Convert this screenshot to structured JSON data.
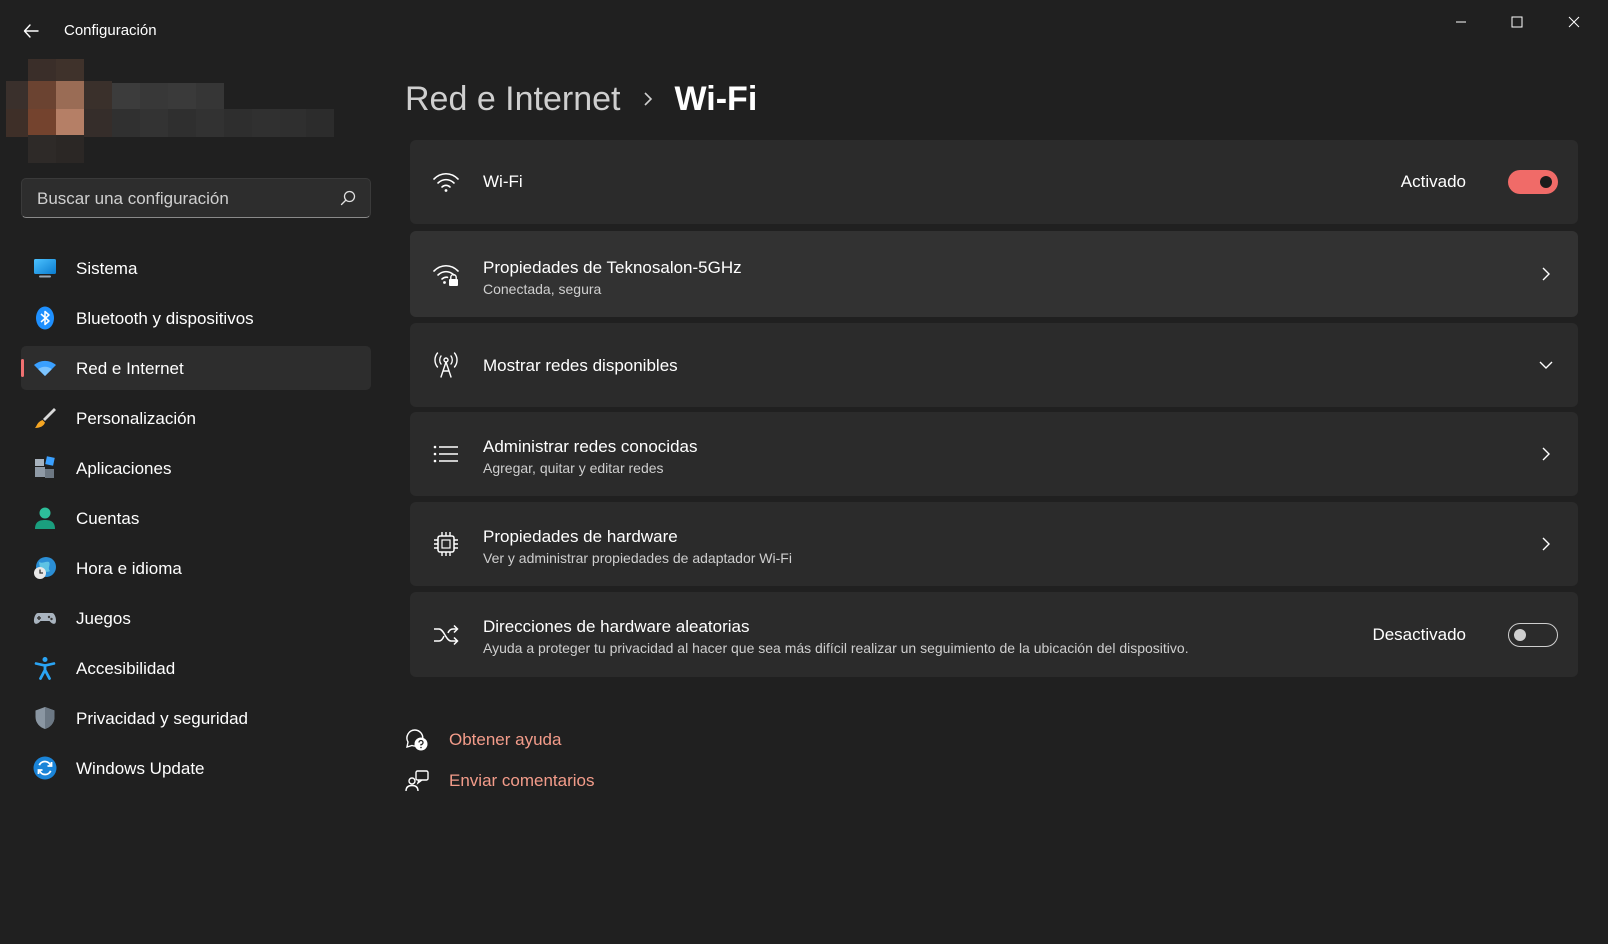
{
  "window": {
    "title": "Configuración",
    "minimize_icon": "minimize-icon",
    "maximize_icon": "maximize-icon",
    "close_icon": "close-icon"
  },
  "search": {
    "placeholder": "Buscar una configuración"
  },
  "sidebar": {
    "items": [
      {
        "label": "Sistema",
        "icon": "monitor-icon",
        "active": false
      },
      {
        "label": "Bluetooth y dispositivos",
        "icon": "bluetooth-icon",
        "active": false
      },
      {
        "label": "Red e Internet",
        "icon": "wifi-icon",
        "active": true
      },
      {
        "label": "Personalización",
        "icon": "paintbrush-icon",
        "active": false
      },
      {
        "label": "Aplicaciones",
        "icon": "apps-icon",
        "active": false
      },
      {
        "label": "Cuentas",
        "icon": "person-icon",
        "active": false
      },
      {
        "label": "Hora e idioma",
        "icon": "globe-clock-icon",
        "active": false
      },
      {
        "label": "Juegos",
        "icon": "gamepad-icon",
        "active": false
      },
      {
        "label": "Accesibilidad",
        "icon": "accessibility-icon",
        "active": false
      },
      {
        "label": "Privacidad y seguridad",
        "icon": "shield-icon",
        "active": false
      },
      {
        "label": "Windows Update",
        "icon": "update-icon",
        "active": false
      }
    ]
  },
  "breadcrumb": {
    "parent": "Red e Internet",
    "current": "Wi-Fi"
  },
  "cards": {
    "wifi": {
      "title": "Wi-Fi",
      "state": "Activado",
      "toggle_on": true
    },
    "properties": {
      "title": "Propiedades de Teknosalon-5GHz",
      "subtitle": "Conectada, segura"
    },
    "available": {
      "title": "Mostrar redes disponibles"
    },
    "known": {
      "title": "Administrar redes conocidas",
      "subtitle": "Agregar, quitar y editar redes"
    },
    "hardware": {
      "title": "Propiedades de hardware",
      "subtitle": "Ver y administrar propiedades de adaptador Wi-Fi"
    },
    "random": {
      "title": "Direcciones de hardware aleatorias",
      "subtitle": "Ayuda a proteger tu privacidad al hacer que sea más difícil realizar un seguimiento de la ubicación del dispositivo.",
      "state": "Desactivado",
      "toggle_on": false
    }
  },
  "links": {
    "help": "Obtener ayuda",
    "feedback": "Enviar comentarios"
  },
  "colors": {
    "accent": "#f06b68",
    "link": "#f39c8a",
    "background": "#202020",
    "card": "#2b2b2b"
  }
}
